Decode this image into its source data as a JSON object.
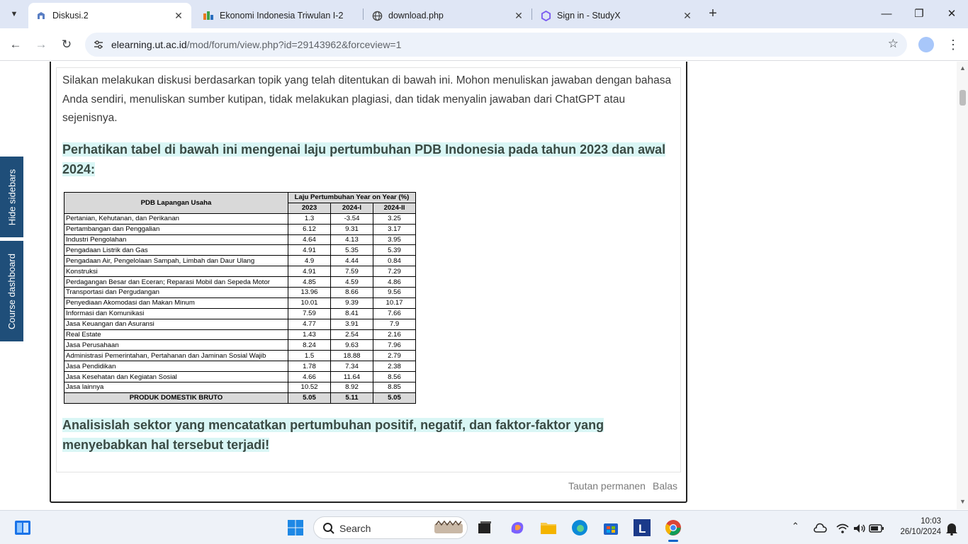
{
  "browser": {
    "tabs": [
      {
        "title": "Diskusi.2",
        "active": true
      },
      {
        "title": "Ekonomi Indonesia Triwulan I-2",
        "active": false
      },
      {
        "title": "download.php",
        "active": false
      },
      {
        "title": "Sign in - StudyX",
        "active": false
      }
    ],
    "url_host": "elearning.ut.ac.id",
    "url_path": "/mod/forum/view.php?id=29143962&forceview=1"
  },
  "sidebar": {
    "hide_label": "Hide sidebars",
    "dashboard_label": "Course dashboard"
  },
  "post": {
    "intro": "Silakan melakukan diskusi berdasarkan topik yang telah ditentukan di bawah ini. Mohon menuliskan jawaban dengan bahasa Anda sendiri, menuliskan sumber kutipan, tidak melakukan plagiasi, dan tidak menyalin jawaban dari ChatGPT atau sejenisnya.",
    "question1": "Perhatikan tabel di bawah ini mengenai laju pertumbuhan PDB Indonesia pada tahun 2023 dan awal 2024:",
    "question2": "Analisislah sektor yang mencatatkan pertumbuhan positif, negatif, dan faktor-faktor yang menyebabkan hal tersebut terjadi!",
    "permalink_label": "Tautan permanen",
    "reply_label": "Balas"
  },
  "table": {
    "header_sector": "PDB Lapangan Usaha",
    "header_growth": "Laju Pertumbuhan Year on Year (%)",
    "cols": [
      "2023",
      "2024-I",
      "2024-II"
    ],
    "rows": [
      {
        "sector": "Pertanian, Kehutanan, dan Perikanan",
        "v": [
          "1.3",
          "-3.54",
          "3.25"
        ]
      },
      {
        "sector": "Pertambangan dan Penggalian",
        "v": [
          "6.12",
          "9.31",
          "3.17"
        ]
      },
      {
        "sector": "Industri Pengolahan",
        "v": [
          "4.64",
          "4.13",
          "3.95"
        ]
      },
      {
        "sector": "Pengadaan Listrik dan Gas",
        "v": [
          "4.91",
          "5.35",
          "5.39"
        ]
      },
      {
        "sector": "Pengadaan Air, Pengelolaan Sampah, Limbah dan Daur Ulang",
        "v": [
          "4.9",
          "4.44",
          "0.84"
        ]
      },
      {
        "sector": "Konstruksi",
        "v": [
          "4.91",
          "7.59",
          "7.29"
        ]
      },
      {
        "sector": "Perdagangan Besar dan Eceran; Reparasi Mobil dan Sepeda Motor",
        "v": [
          "4.85",
          "4.59",
          "4.86"
        ]
      },
      {
        "sector": "Transportasi dan Pergudangan",
        "v": [
          "13.96",
          "8.66",
          "9.56"
        ]
      },
      {
        "sector": "Penyediaan Akomodasi dan Makan Minum",
        "v": [
          "10.01",
          "9.39",
          "10.17"
        ]
      },
      {
        "sector": "Informasi dan Komunikasi",
        "v": [
          "7.59",
          "8.41",
          "7.66"
        ]
      },
      {
        "sector": "Jasa Keuangan dan Asuransi",
        "v": [
          "4.77",
          "3.91",
          "7.9"
        ]
      },
      {
        "sector": "Real Estate",
        "v": [
          "1.43",
          "2.54",
          "2.16"
        ]
      },
      {
        "sector": "Jasa Perusahaan",
        "v": [
          "8.24",
          "9.63",
          "7.96"
        ]
      },
      {
        "sector": "Administrasi Pemerintahan, Pertahanan dan Jaminan Sosial Wajib",
        "v": [
          "1.5",
          "18.88",
          "2.79"
        ]
      },
      {
        "sector": "Jasa Pendidikan",
        "v": [
          "1.78",
          "7.34",
          "2.38"
        ]
      },
      {
        "sector": "Jasa Kesehatan dan Kegiatan Sosial",
        "v": [
          "4.66",
          "11.64",
          "8.56"
        ]
      },
      {
        "sector": "Jasa lainnya",
        "v": [
          "10.52",
          "8.92",
          "8.85"
        ]
      }
    ],
    "total": {
      "sector": "PRODUK DOMESTIK BRUTO",
      "v": [
        "5.05",
        "5.11",
        "5.05"
      ]
    }
  },
  "taskbar": {
    "search_label": "Search",
    "time": "10:03",
    "date": "26/10/2024"
  },
  "colors": {
    "highlight": "#d9f6f5",
    "sidebar_tab": "#1f4e79"
  }
}
